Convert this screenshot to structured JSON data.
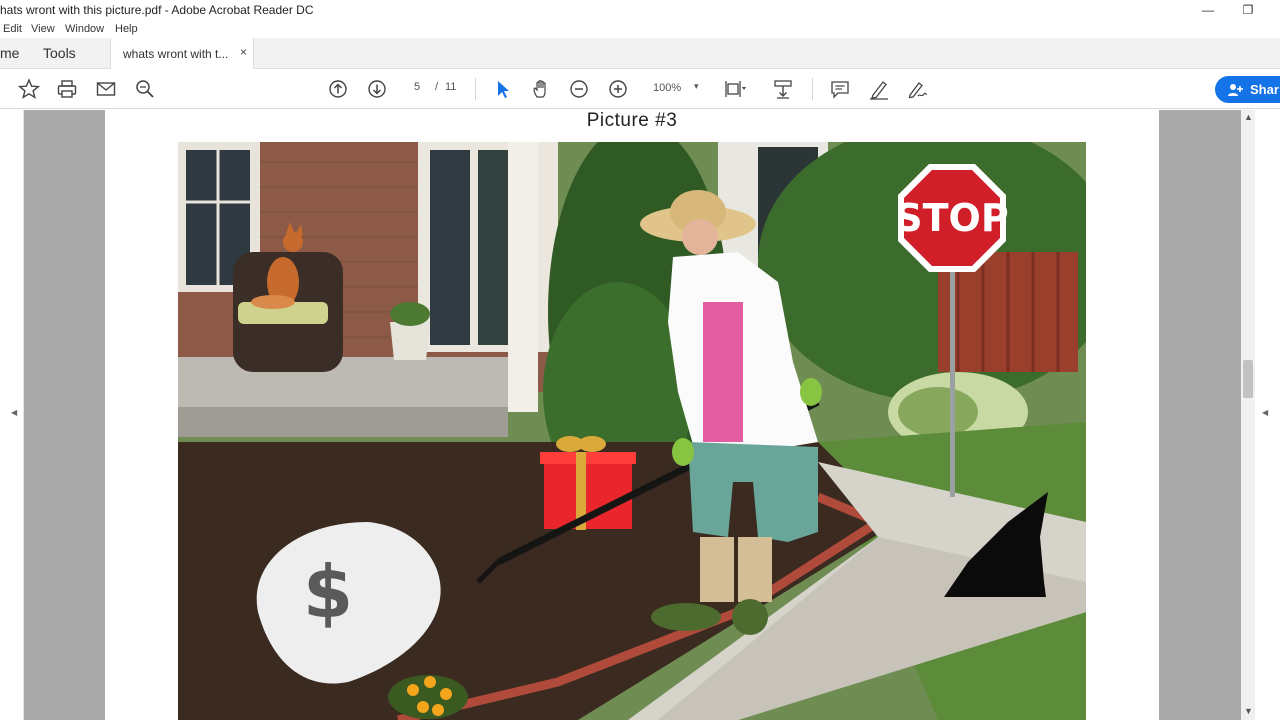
{
  "window": {
    "title": "hats wront with this picture.pdf - Adobe Acrobat Reader DC",
    "minimize_glyph": "—",
    "restore_glyph": "❐"
  },
  "menu": [
    "Edit",
    "View",
    "Window",
    "Help"
  ],
  "tabs": {
    "home_label": "me",
    "tools_label": "Tools",
    "document_label": "whats wront with t...",
    "close_glyph": "×"
  },
  "toolbar": {
    "page_current": "5",
    "page_separator": "/",
    "page_total": "11",
    "zoom": "100%",
    "zoom_caret": "▾",
    "share_label": "Shar"
  },
  "document": {
    "picture_title": "Picture #3",
    "stop_sign_text": "STOP",
    "bag_symbol": "$"
  },
  "scroll": {
    "up_glyph": "▲",
    "down_glyph": "▼",
    "left_glyph": "◀",
    "right_glyph": "◀"
  },
  "colors": {
    "accent": "#1473e6",
    "stop_red": "#d11f2a",
    "gift_red": "#e8262c",
    "ribbon_gold": "#d9a93a"
  }
}
